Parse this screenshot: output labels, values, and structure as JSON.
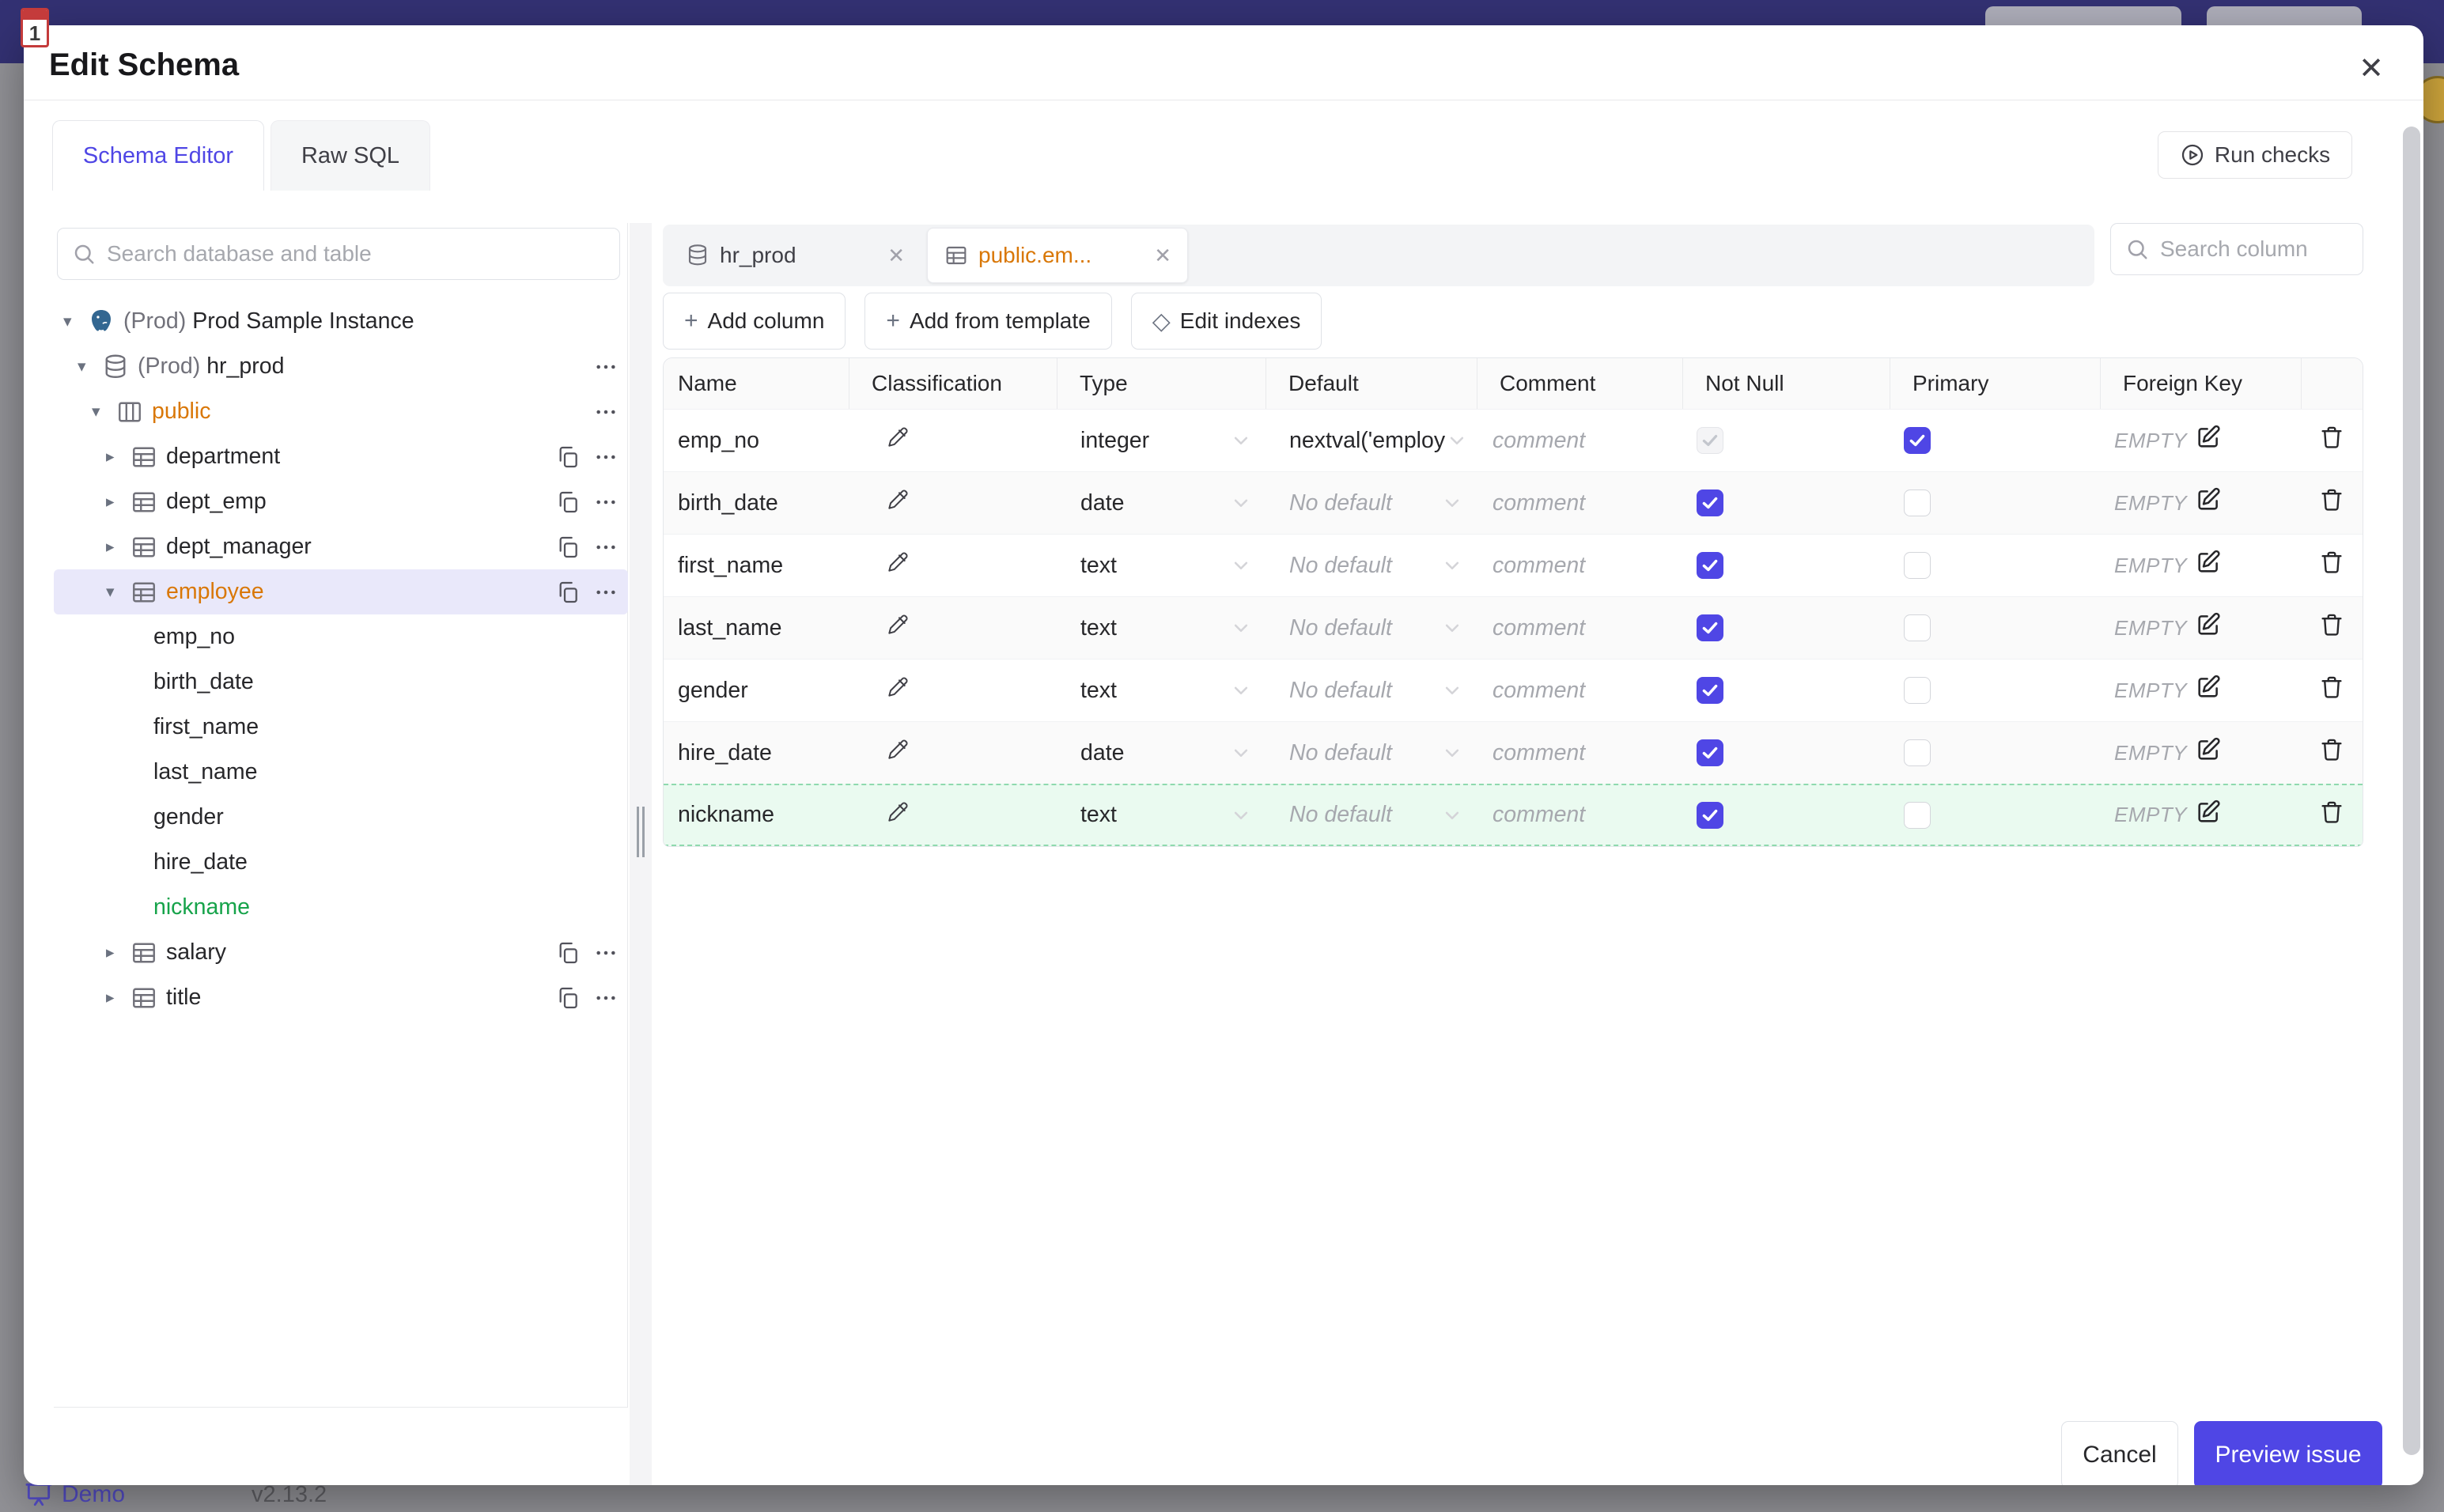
{
  "backdrop": {
    "demo_label": "Demo",
    "version": "v2.13.2",
    "favicon_glyph": "1",
    "topbar_color": "#333173",
    "accent_color": "#4f46e5"
  },
  "modal": {
    "title": "Edit Schema",
    "close_glyph": "✕",
    "tabs": [
      {
        "label": "Schema Editor",
        "active": true
      },
      {
        "label": "Raw SQL",
        "active": false
      }
    ],
    "run_checks_label": "Run checks"
  },
  "sidebar": {
    "search_placeholder": "Search database and table",
    "tree": [
      {
        "depth": 0,
        "icon": "postgres",
        "caret": "down",
        "prefix": "(Prod)",
        "label": "Prod Sample Instance"
      },
      {
        "depth": 1,
        "icon": "database",
        "caret": "down",
        "prefix": "(Prod)",
        "label": "hr_prod",
        "more": true
      },
      {
        "depth": 2,
        "icon": "schema",
        "caret": "down",
        "label": "public",
        "color": "orange",
        "more": true
      },
      {
        "depth": 3,
        "icon": "table",
        "caret": "right",
        "label": "department",
        "copy": true,
        "more": true
      },
      {
        "depth": 3,
        "icon": "table",
        "caret": "right",
        "label": "dept_emp",
        "copy": true,
        "more": true
      },
      {
        "depth": 3,
        "icon": "table",
        "caret": "right",
        "label": "dept_manager",
        "copy": true,
        "more": true
      },
      {
        "depth": 3,
        "icon": "table",
        "caret": "down",
        "label": "employee",
        "color": "orange",
        "selected": true,
        "copy": true,
        "more": true
      },
      {
        "depth": 4,
        "label": "emp_no"
      },
      {
        "depth": 4,
        "label": "birth_date"
      },
      {
        "depth": 4,
        "label": "first_name"
      },
      {
        "depth": 4,
        "label": "last_name"
      },
      {
        "depth": 4,
        "label": "gender"
      },
      {
        "depth": 4,
        "label": "hire_date"
      },
      {
        "depth": 4,
        "label": "nickname",
        "color": "green"
      },
      {
        "depth": 3,
        "icon": "table",
        "caret": "right",
        "label": "salary",
        "copy": true,
        "more": true
      },
      {
        "depth": 3,
        "icon": "table",
        "caret": "right",
        "label": "title",
        "copy": true,
        "more": true
      }
    ]
  },
  "editor": {
    "open_tabs": [
      {
        "label": "hr_prod",
        "icon": "database",
        "active": false
      },
      {
        "label": "public.em...",
        "icon": "table",
        "active": true
      }
    ],
    "column_search_placeholder": "Search column",
    "actions": [
      {
        "icon": "plus",
        "label": "Add column"
      },
      {
        "icon": "plus",
        "label": "Add from template"
      },
      {
        "icon": "diamond",
        "label": "Edit indexes"
      }
    ],
    "table": {
      "headers": [
        "Name",
        "Classification",
        "Type",
        "Default",
        "Comment",
        "Not Null",
        "Primary",
        "Foreign Key",
        ""
      ],
      "comment_placeholder": "comment",
      "foreign_key_empty": "EMPTY",
      "rows": [
        {
          "name": "emp_no",
          "type": "integer",
          "default": "nextval('employ",
          "has_default": true,
          "not_null": true,
          "not_null_disabled": true,
          "primary": true,
          "is_new": false
        },
        {
          "name": "birth_date",
          "type": "date",
          "default": "No default",
          "has_default": false,
          "not_null": true,
          "not_null_disabled": false,
          "primary": false,
          "is_new": false
        },
        {
          "name": "first_name",
          "type": "text",
          "default": "No default",
          "has_default": false,
          "not_null": true,
          "not_null_disabled": false,
          "primary": false,
          "is_new": false
        },
        {
          "name": "last_name",
          "type": "text",
          "default": "No default",
          "has_default": false,
          "not_null": true,
          "not_null_disabled": false,
          "primary": false,
          "is_new": false
        },
        {
          "name": "gender",
          "type": "text",
          "default": "No default",
          "has_default": false,
          "not_null": true,
          "not_null_disabled": false,
          "primary": false,
          "is_new": false
        },
        {
          "name": "hire_date",
          "type": "date",
          "default": "No default",
          "has_default": false,
          "not_null": true,
          "not_null_disabled": false,
          "primary": false,
          "is_new": false
        },
        {
          "name": "nickname",
          "type": "text",
          "default": "No default",
          "has_default": false,
          "not_null": true,
          "not_null_disabled": false,
          "primary": false,
          "is_new": true
        }
      ]
    }
  },
  "footer": {
    "cancel_label": "Cancel",
    "submit_label": "Preview issue"
  }
}
